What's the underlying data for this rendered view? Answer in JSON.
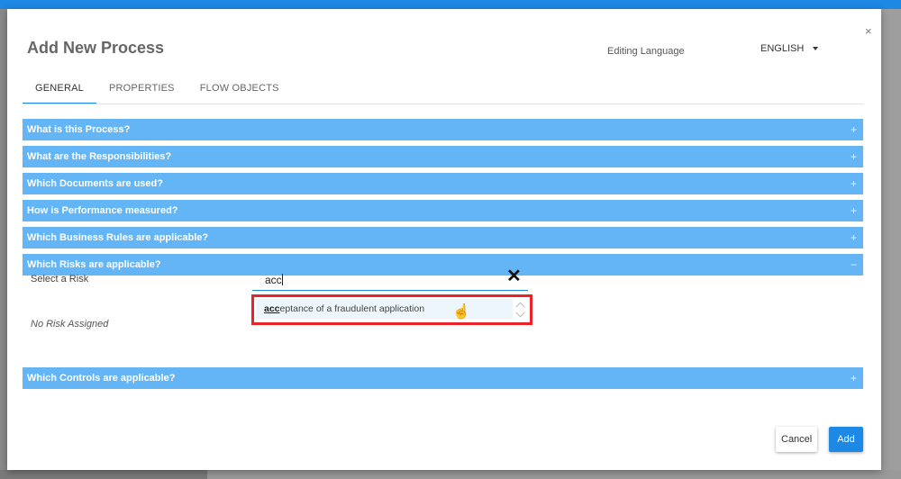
{
  "modal": {
    "title": "Add New Process",
    "close_icon": "×",
    "editing_language_label": "Editing Language",
    "language_value": "ENGLISH"
  },
  "tabs": [
    {
      "label": "GENERAL",
      "active": true
    },
    {
      "label": "PROPERTIES",
      "active": false
    },
    {
      "label": "FLOW OBJECTS",
      "active": false
    }
  ],
  "sections": [
    {
      "label": "What is this Process?",
      "sign": "+"
    },
    {
      "label": "What are the Responsibilities?",
      "sign": "+"
    },
    {
      "label": "Which Documents are used?",
      "sign": "+"
    },
    {
      "label": "How is Performance measured?",
      "sign": "+"
    },
    {
      "label": "Which Business Rules are applicable?",
      "sign": "+"
    },
    {
      "label": "Which Risks are applicable?",
      "sign": "−"
    },
    {
      "label": "Which Controls are applicable?",
      "sign": "+"
    }
  ],
  "risk": {
    "select_label": "Select a Risk",
    "input_value": "acc",
    "clear_icon": "✕",
    "suggestion_match": "acc",
    "suggestion_rest": "eptance of a fraudulent application",
    "empty_text": "No Risk Assigned"
  },
  "footer": {
    "cancel_label": "Cancel",
    "add_label": "Add"
  },
  "colors": {
    "accent": "#1e88e5",
    "section_bar": "#64b5f6",
    "highlight_border": "#e8232a"
  }
}
